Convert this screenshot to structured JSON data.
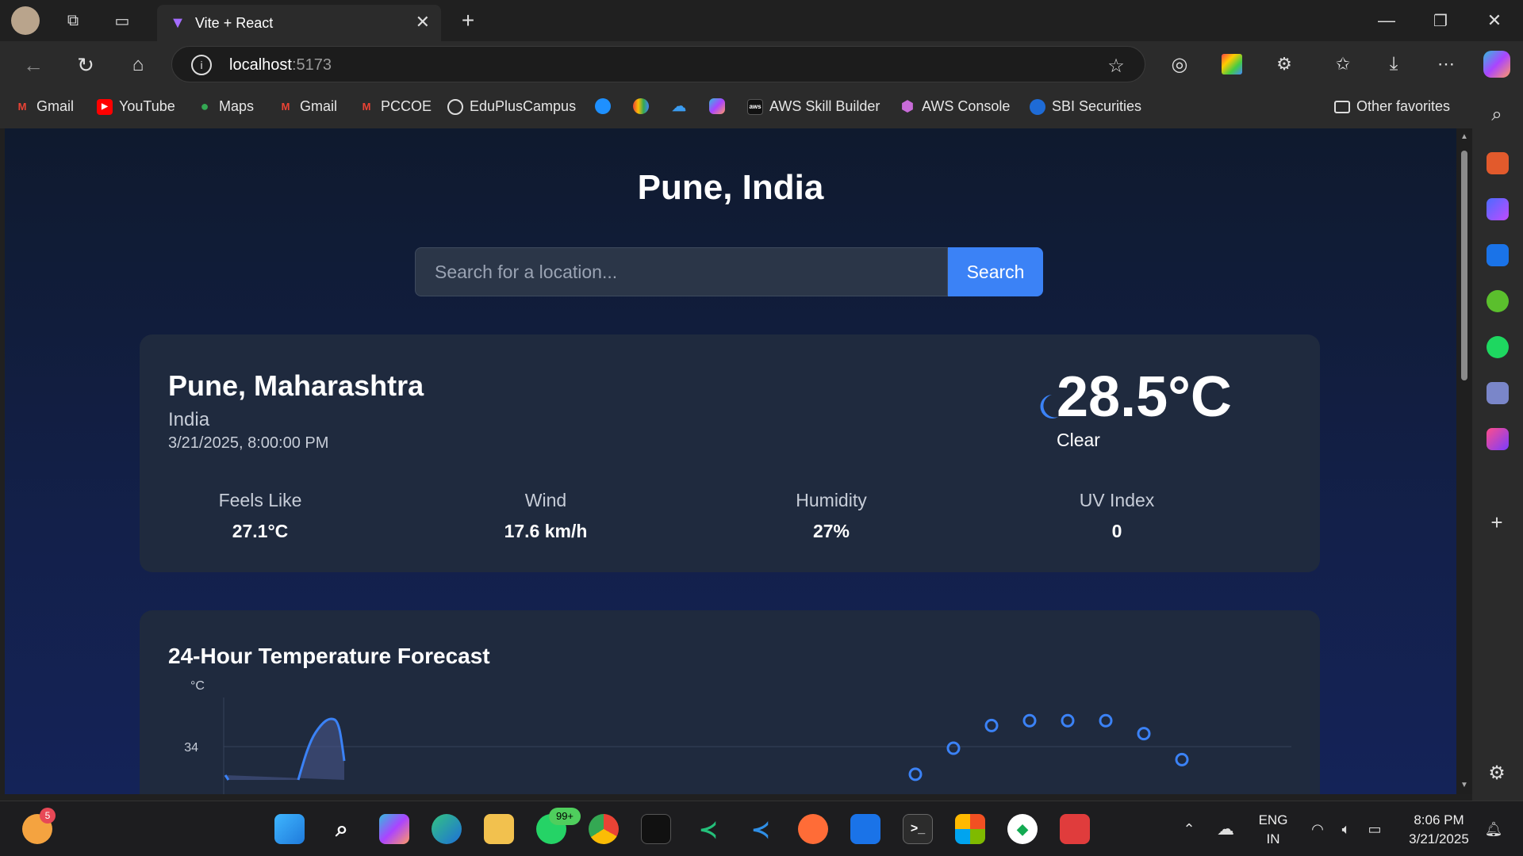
{
  "browser": {
    "tab_title": "Vite + React",
    "url_host": "localhost",
    "url_port": ":5173",
    "bookmarks": [
      "Gmail",
      "YouTube",
      "Maps",
      "Gmail",
      "PCCOE",
      "EduPlusCampus",
      "AWS Skill Builder",
      "AWS Console",
      "SBI Securities"
    ],
    "other_favorites": "Other favorites"
  },
  "page": {
    "title": "Pune, India",
    "search_placeholder": "Search for a location...",
    "search_button": "Search",
    "current": {
      "location": "Pune, Maharashtra",
      "country": "India",
      "datetime": "3/21/2025, 8:00:00 PM",
      "temperature": "28.5°C",
      "condition": "Clear",
      "icon": "moon-icon",
      "stats": [
        {
          "label": "Feels Like",
          "value": "27.1°C"
        },
        {
          "label": "Wind",
          "value": "17.6 km/h"
        },
        {
          "label": "Humidity",
          "value": "27%"
        },
        {
          "label": "UV Index",
          "value": "0"
        }
      ]
    },
    "forecast": {
      "title": "24-Hour Temperature Forecast",
      "unit_label": "°C",
      "tick": "34"
    }
  },
  "chart_data": {
    "type": "line",
    "title": "24-Hour Temperature Forecast",
    "ylabel": "°C",
    "y_ticks": [
      34
    ],
    "note": "chart partially visible; points near top of range",
    "series": [
      {
        "values": [
          32.3,
          33.9,
          35.3,
          35.6,
          35.6,
          35.6,
          34.8,
          33.2
        ]
      }
    ]
  },
  "taskbar": {
    "time": "8:06 PM",
    "date": "3/21/2025",
    "lang_top": "ENG",
    "lang_bottom": "IN",
    "badge_whatsapp": "99+",
    "badge_weather": "5"
  },
  "colors": {
    "accent": "#3b82f6",
    "page_bg": "#0f1a2e",
    "card": "#1f2a3e"
  }
}
